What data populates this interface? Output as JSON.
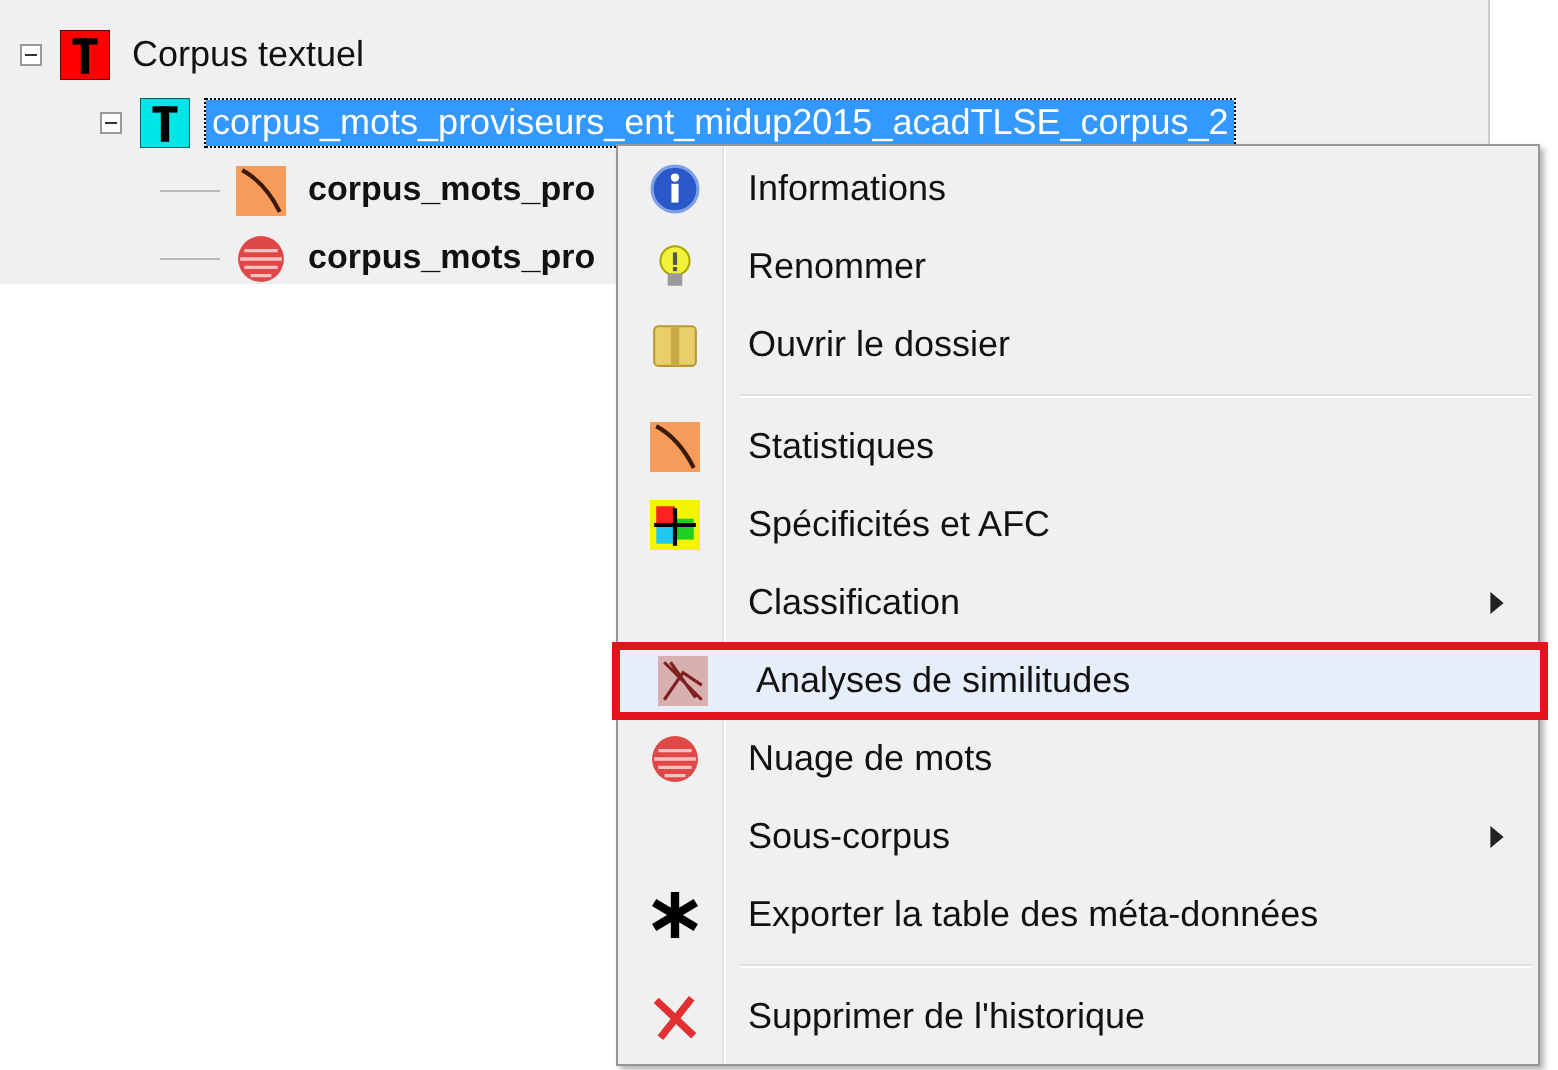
{
  "tree": [
    {
      "label": "Corpus textuel",
      "kind": "corpus",
      "expanded": true,
      "selected": false,
      "children": [
        {
          "label": "corpus_mots_proviseurs_ent_midup2015_acadTLSE_corpus_2",
          "kind": "subcorpus",
          "expanded": true,
          "selected": true,
          "children": [
            {
              "label": "corpus_mots_pro",
              "kind": "stats",
              "selected": false
            },
            {
              "label": "corpus_mots_pro",
              "kind": "cloud",
              "selected": false
            }
          ]
        }
      ]
    }
  ],
  "context_menu": [
    {
      "kind": "info",
      "label": "Informations",
      "selected": false
    },
    {
      "kind": "rename",
      "label": "Renommer",
      "selected": false
    },
    {
      "kind": "folder",
      "label": "Ouvrir le dossier",
      "selected": false
    },
    {
      "kind": "separator"
    },
    {
      "kind": "stats",
      "label": "Statistiques",
      "selected": false
    },
    {
      "kind": "afc",
      "label": "Spécificités et AFC",
      "selected": false
    },
    {
      "kind": "submenu",
      "label": "Classification",
      "selected": false
    },
    {
      "kind": "similitude",
      "label": "Analyses de similitudes",
      "selected": true
    },
    {
      "kind": "cloud",
      "label": "Nuage de mots",
      "selected": false
    },
    {
      "kind": "submenu",
      "label": "Sous-corpus",
      "selected": false
    },
    {
      "kind": "export",
      "label": "Exporter la table des méta-données",
      "selected": false
    },
    {
      "kind": "separator"
    },
    {
      "kind": "delete",
      "label": "Supprimer de l'historique",
      "selected": false
    }
  ]
}
